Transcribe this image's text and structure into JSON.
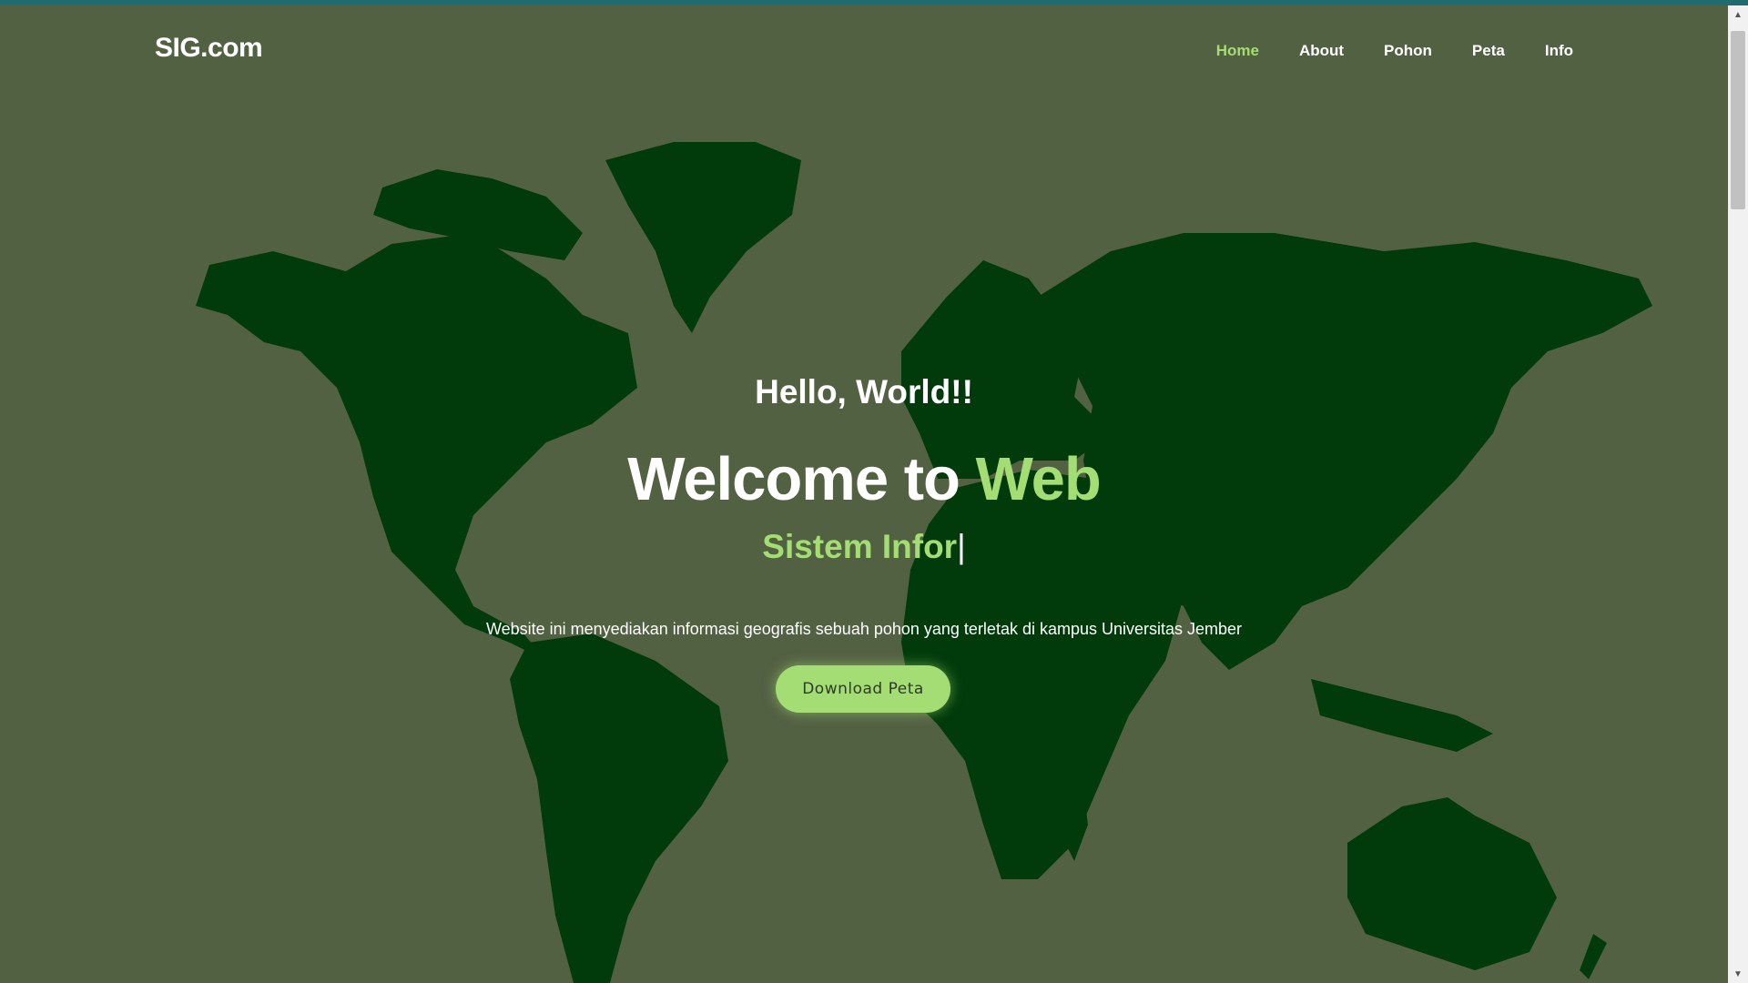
{
  "browser": {
    "accent_color": "#1f6b6e"
  },
  "navbar": {
    "brand": "SIG.com",
    "items": [
      {
        "label": "Home",
        "active": true
      },
      {
        "label": "About",
        "active": false
      },
      {
        "label": "Pohon",
        "active": false
      },
      {
        "label": "Peta",
        "active": false
      },
      {
        "label": "Info",
        "active": false
      }
    ]
  },
  "hero": {
    "greeting": "Hello, World!!",
    "title_prefix": "Welcome to",
    "title_accent": "Web",
    "typed_text": "Sistem Infor",
    "cursor": "|",
    "description": "Website ini menyediakan informasi geografis sebuah pohon yang terletak di kampus Universitas Jember",
    "button_label": "Download Peta"
  },
  "colors": {
    "background": "#536143",
    "land": "#023b0b",
    "accent": "#a4dd74",
    "text": "#ffffff"
  },
  "icons": {
    "scroll_up": "triangle-up-icon",
    "scroll_down": "triangle-down-icon"
  }
}
